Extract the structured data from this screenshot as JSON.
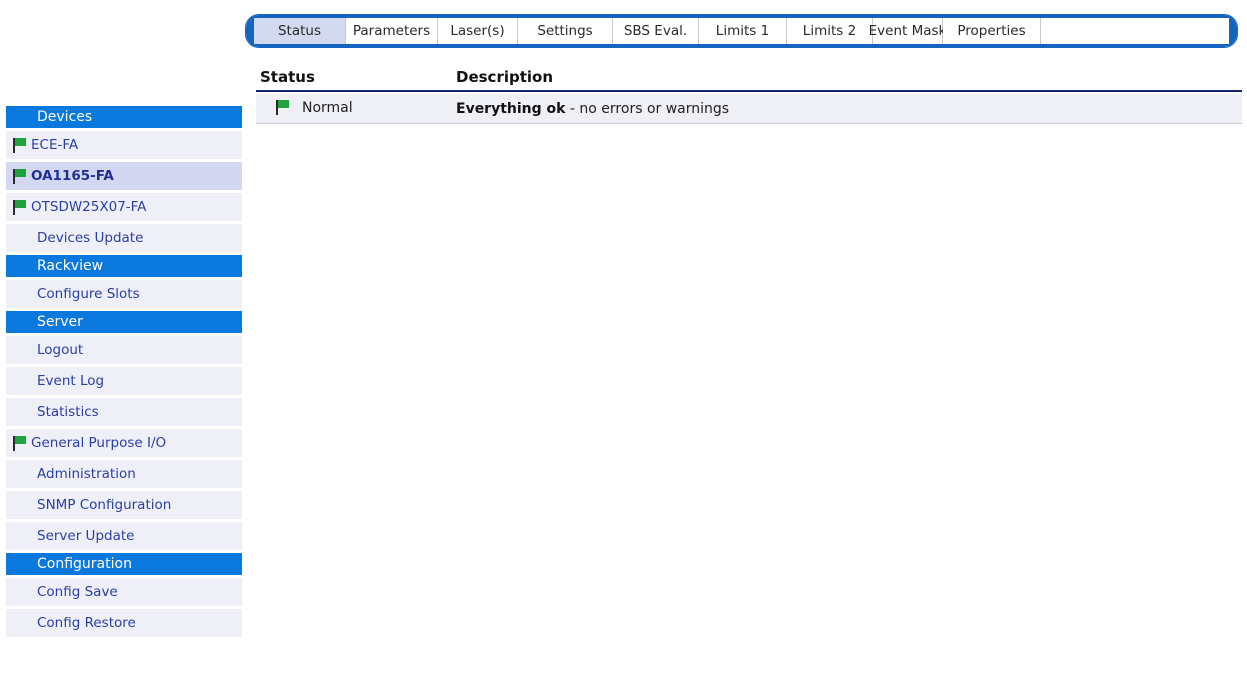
{
  "tabs": [
    {
      "label": "Status",
      "active": true
    },
    {
      "label": "Parameters",
      "active": false
    },
    {
      "label": "Laser(s)",
      "active": false
    },
    {
      "label": "Settings",
      "active": false
    },
    {
      "label": "SBS Eval.",
      "active": false
    },
    {
      "label": "Limits 1",
      "active": false
    },
    {
      "label": "Limits 2",
      "active": false
    },
    {
      "label": "Event Mask",
      "active": false
    },
    {
      "label": "Properties",
      "active": false
    },
    {
      "label": "",
      "active": false
    }
  ],
  "sidebar": {
    "devices": {
      "header": "Devices",
      "items": [
        {
          "label": "ECE-FA",
          "flag": true,
          "selected": false
        },
        {
          "label": "OA1165-FA",
          "flag": true,
          "selected": true
        },
        {
          "label": "OTSDW25X07-FA",
          "flag": true,
          "selected": false
        },
        {
          "label": "Devices Update",
          "flag": false,
          "selected": false
        }
      ]
    },
    "rackview": {
      "header": "Rackview",
      "items": [
        {
          "label": "Configure Slots",
          "flag": false,
          "selected": false
        }
      ]
    },
    "server": {
      "header": "Server",
      "items": [
        {
          "label": "Logout",
          "flag": false,
          "selected": false
        },
        {
          "label": "Event Log",
          "flag": false,
          "selected": false
        },
        {
          "label": "Statistics",
          "flag": false,
          "selected": false
        },
        {
          "label": "General Purpose I/O",
          "flag": true,
          "selected": false
        },
        {
          "label": "Administration",
          "flag": false,
          "selected": false
        },
        {
          "label": "SNMP Configuration",
          "flag": false,
          "selected": false
        },
        {
          "label": "Server Update",
          "flag": false,
          "selected": false
        }
      ]
    },
    "configuration": {
      "header": "Configuration",
      "items": [
        {
          "label": "Config Save",
          "flag": false,
          "selected": false
        },
        {
          "label": "Config Restore",
          "flag": false,
          "selected": false
        }
      ]
    }
  },
  "table": {
    "headers": {
      "status": "Status",
      "description": "Description"
    },
    "rows": [
      {
        "status": "Normal",
        "status_icon": "green-flag-icon",
        "desc_bold": "Everything ok",
        "desc_rest": " - no errors or warnings"
      }
    ]
  },
  "colors": {
    "accent": "#0a78dd",
    "flag_green": "#1fa33c",
    "selected_bg": "#d4d7f2",
    "row_bg": "#eff0f6"
  }
}
